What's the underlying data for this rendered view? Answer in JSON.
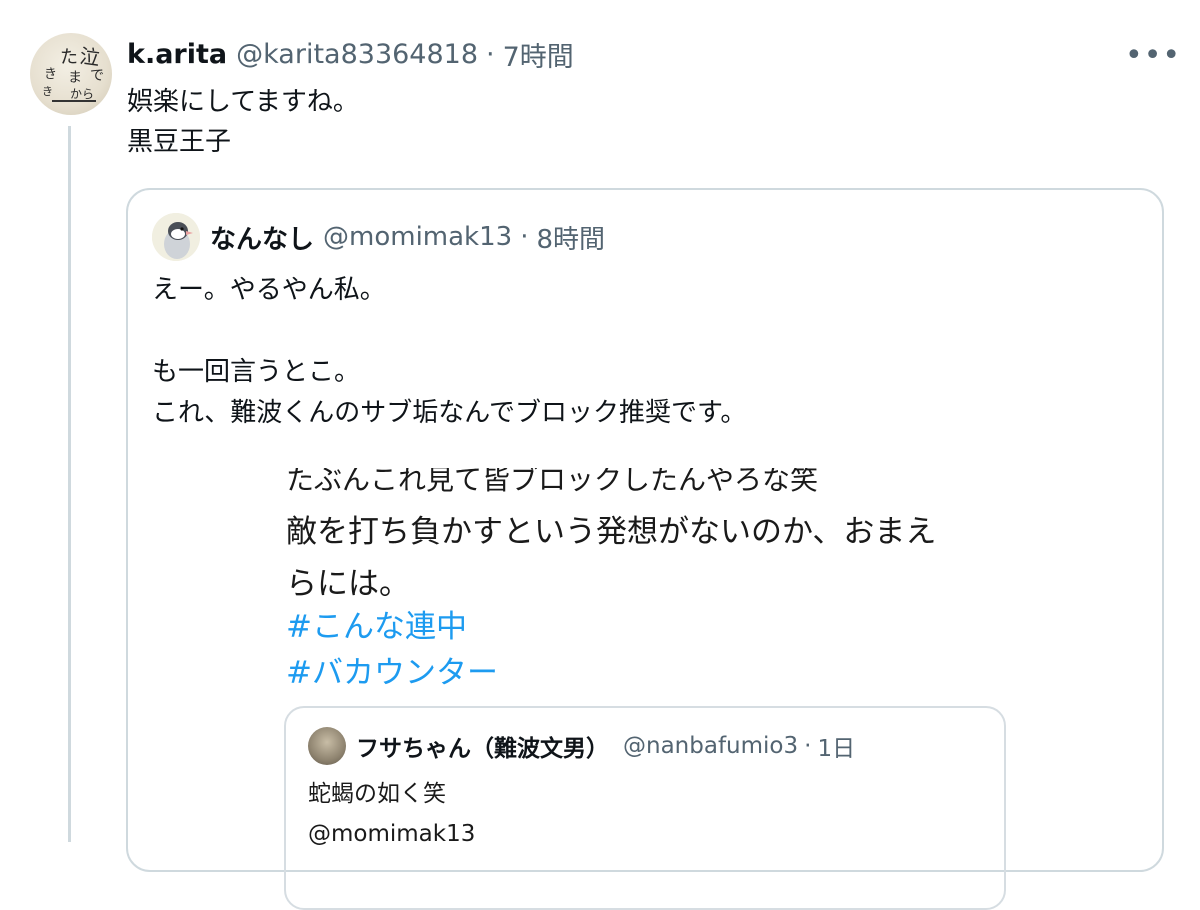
{
  "tweet": {
    "author_name": "k.arita",
    "author_handle": "@karita83364818",
    "separator": "·",
    "time": "7時間",
    "more_label": "•••",
    "text_line1": "娯楽にしてますね。",
    "text_line2": "黒豆王子"
  },
  "quote": {
    "author_name": "なんなし",
    "author_handle": "@momimak13",
    "separator": "·",
    "time": "8時間",
    "text": "えー。やるやん私。\n\nも一回言うとこ。\nこれ、難波くんのサブ垢なんでブロック推奨です。"
  },
  "screenshot": {
    "cut_line": "たぶんこれ見て皆ブロックしたんやろな笑",
    "body": "敵を打ち負かすという発想がないのか、おまえ\nらには。",
    "hashtags": [
      "#こんな連中",
      "#バカウンター"
    ],
    "inner": {
      "author_name": "フサちゃん（難波文男）",
      "author_handle": "@nanbafumio3",
      "separator": "·",
      "time": "1日",
      "text": "蛇蝎の如く笑\n@momimak13"
    }
  },
  "icons": {
    "more": "more-horizontal-icon"
  },
  "colors": {
    "link": "#1d9bf0",
    "secondary_text": "#536471",
    "border": "#cfd9de"
  }
}
